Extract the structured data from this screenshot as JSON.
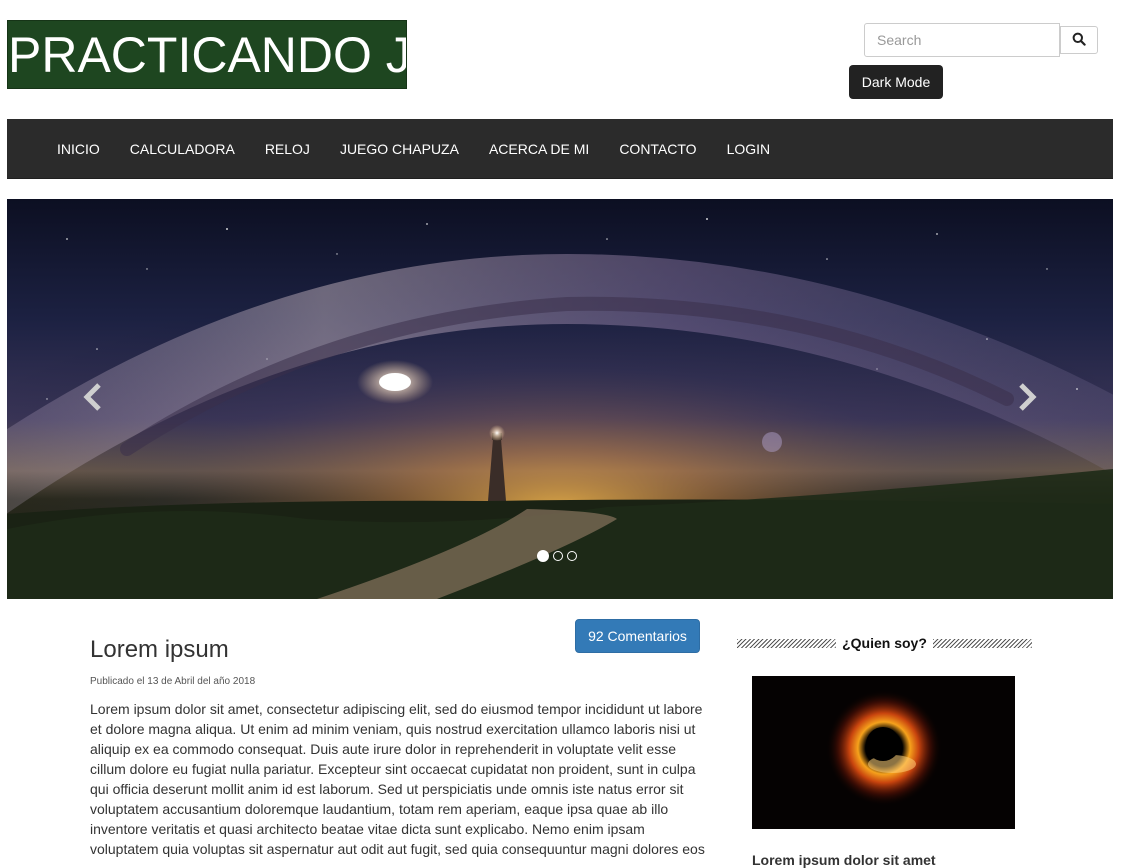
{
  "header": {
    "logo_text": "PRACTICANDO JS",
    "search": {
      "placeholder": "Search",
      "value": ""
    },
    "dark_mode_label": "Dark Mode"
  },
  "nav": {
    "items": [
      {
        "label": "INICIO"
      },
      {
        "label": "CALCULADORA"
      },
      {
        "label": "RELOJ"
      },
      {
        "label": "JUEGO CHAPUZA"
      },
      {
        "label": "ACERCA DE MI"
      },
      {
        "label": "CONTACTO"
      },
      {
        "label": "LOGIN"
      }
    ]
  },
  "carousel": {
    "slide_count": 3,
    "active_index": 0
  },
  "post": {
    "comments_label": "92 Comentarios",
    "title": "Lorem ipsum",
    "meta": "Publicado el 13 de Abril del año 2018",
    "body": "Lorem ipsum dolor sit amet, consectetur adipiscing elit, sed do eiusmod tempor incididunt ut labore et dolore magna aliqua. Ut enim ad minim veniam, quis nostrud exercitation ullamco laboris nisi ut aliquip ex ea commodo consequat. Duis aute irure dolor in reprehenderit in voluptate velit esse cillum dolore eu fugiat nulla pariatur. Excepteur sint occaecat cupidatat non proident, sunt in culpa qui officia deserunt mollit anim id est laborum. Sed ut perspiciatis unde omnis iste natus error sit voluptatem accusantium doloremque laudantium, totam rem aperiam, eaque ipsa quae ab illo inventore veritatis et quasi architecto beatae vitae dicta sunt explicabo. Nemo enim ipsam voluptatem quia voluptas sit aspernatur aut odit aut fugit, sed quia consequuntur magni dolores eos"
  },
  "sidebar": {
    "heading": "¿Quien soy?",
    "caption": "Lorem ipsum dolor sit amet"
  },
  "colors": {
    "logo_bg": "#1e4620",
    "navbar_bg": "#2b2b2b",
    "primary": "#337ab7",
    "dark_button": "#222222"
  },
  "icons": {
    "search": "search-icon",
    "prev": "chevron-left-icon",
    "next": "chevron-right-icon"
  }
}
